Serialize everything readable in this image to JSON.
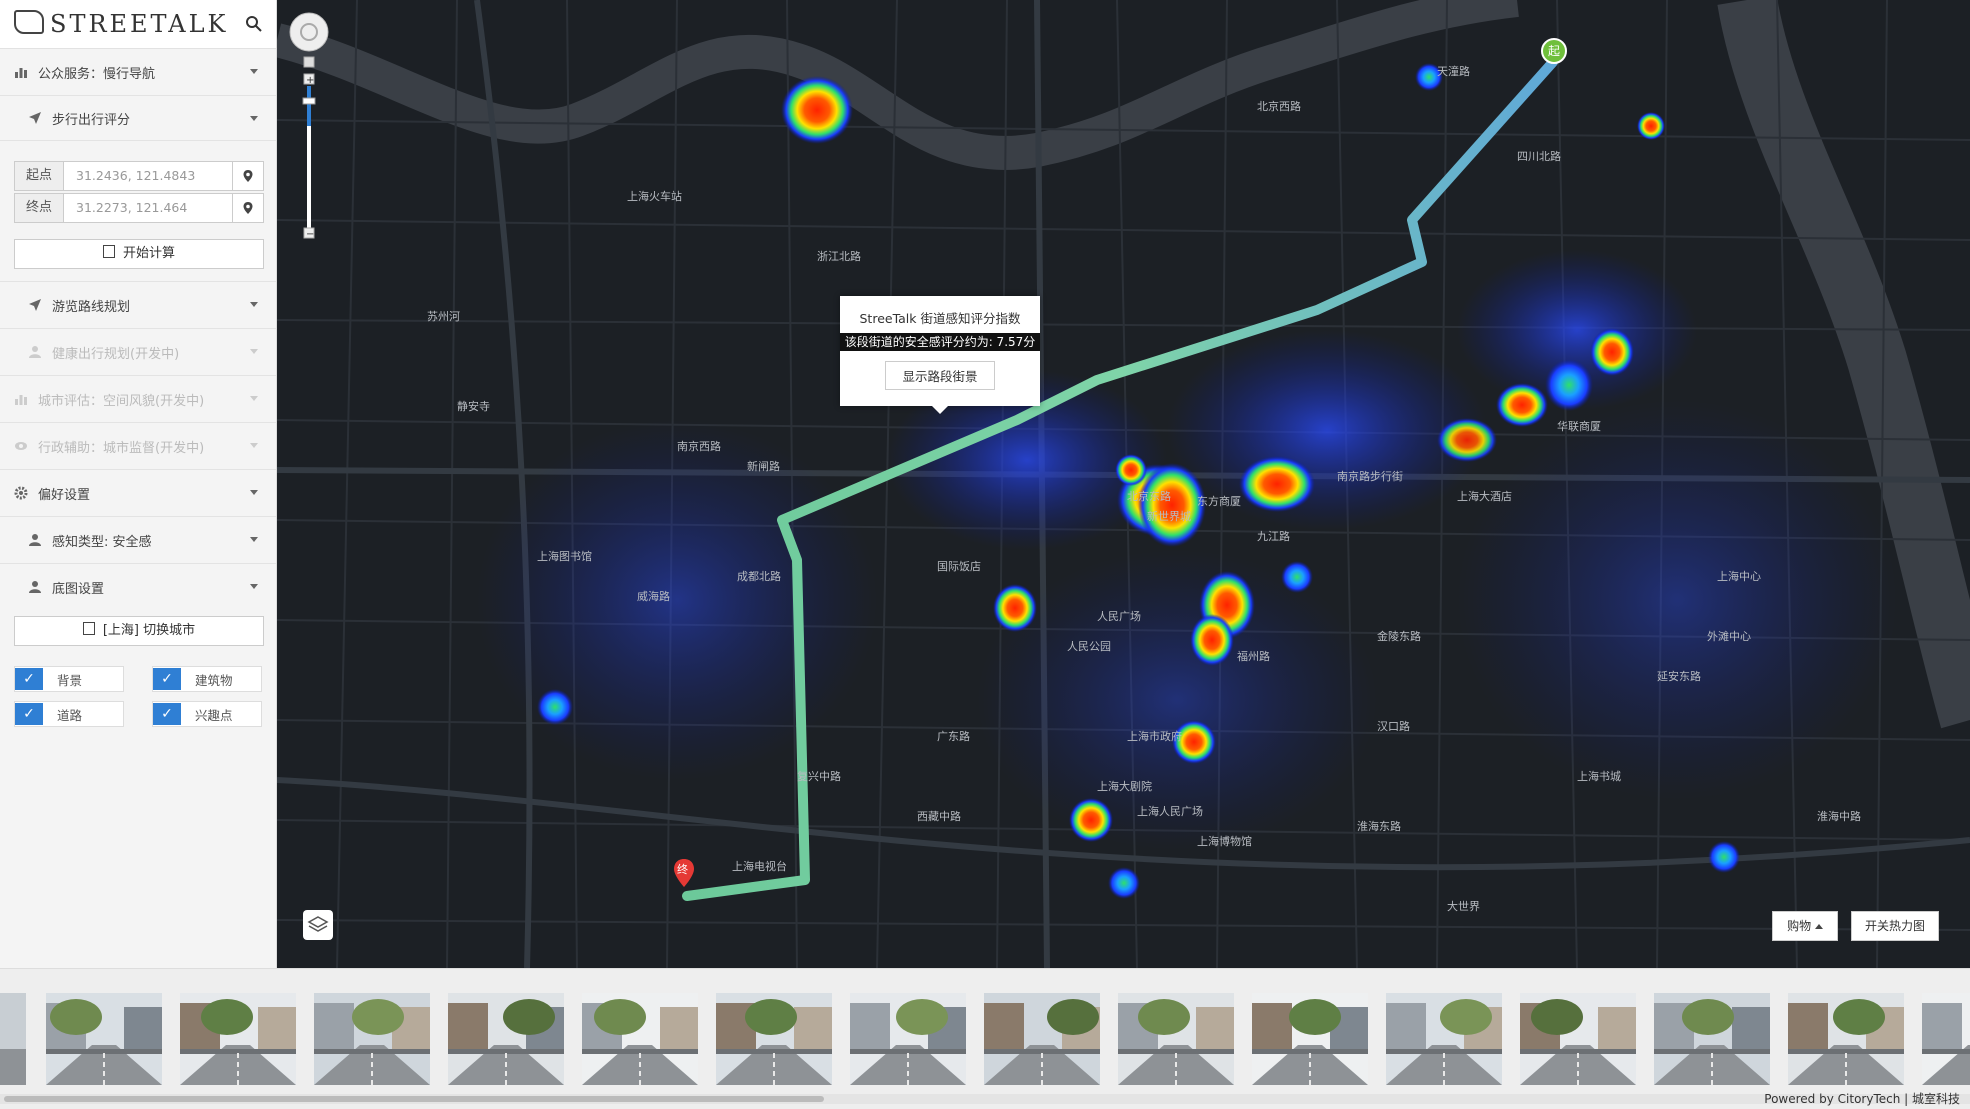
{
  "app": {
    "logo_text": "STREETALK"
  },
  "sidebar": {
    "menu": [
      {
        "label": "公众服务：慢行导航",
        "icon": "bar-chart-icon"
      },
      {
        "label": "步行出行评分",
        "icon": "navigation-arrow-icon"
      },
      {
        "label": "游览路线规划",
        "icon": "navigation-arrow-icon"
      },
      {
        "label": "健康出行规划(开发中)",
        "icon": "user-icon"
      },
      {
        "label": "城市评估：空间风貌(开发中)",
        "icon": "bar-chart-icon"
      },
      {
        "label": "行政辅助：城市监督(开发中)",
        "icon": "eye-icon"
      },
      {
        "label": "偏好设置",
        "icon": "gear-icon"
      },
      {
        "label": "感知类型: 安全感",
        "icon": "user-icon"
      },
      {
        "label": "底图设置",
        "icon": "user-icon"
      }
    ],
    "start_label": "起点",
    "start_value": "31.2436, 121.4843",
    "end_label": "终点",
    "end_value": "31.2273, 121.464",
    "calc_button": "开始计算",
    "switch_city_button": "[上海] 切换城市",
    "layers": [
      {
        "label": "背景",
        "checked": true
      },
      {
        "label": "建筑物",
        "checked": true
      },
      {
        "label": "道路",
        "checked": true
      },
      {
        "label": "兴趣点",
        "checked": true
      }
    ]
  },
  "map": {
    "popup": {
      "title": "StreeTalk 街道感知评分指数",
      "score_text": "该段街道的安全感评分约为: 7.57分",
      "button": "显示路段街景"
    },
    "start_marker": "起",
    "end_marker": "终",
    "category_select": "购物",
    "heatmap_button": "开关热力图",
    "labels": [
      {
        "t": "北京东路"
      },
      {
        "t": "南京路步行街"
      },
      {
        "t": "人民广场"
      },
      {
        "t": "人民公园"
      },
      {
        "t": "上海大剧院"
      },
      {
        "t": "上海市政府"
      },
      {
        "t": "新世界城"
      },
      {
        "t": "东方商厦"
      },
      {
        "t": "九江路"
      },
      {
        "t": "福州路"
      },
      {
        "t": "延安东路"
      },
      {
        "t": "外滩中心"
      },
      {
        "t": "上海大酒店"
      },
      {
        "t": "上海人民广场"
      },
      {
        "t": "淮海东路"
      },
      {
        "t": "上海博物馆"
      },
      {
        "t": "西藏中路"
      },
      {
        "t": "新闸路"
      },
      {
        "t": "北京西路"
      },
      {
        "t": "威海路"
      },
      {
        "t": "上海电视台"
      },
      {
        "t": "南京西路"
      },
      {
        "t": "静安寺"
      },
      {
        "t": "苏州河"
      },
      {
        "t": "上海火车站"
      },
      {
        "t": "天潼路"
      },
      {
        "t": "四川北路"
      },
      {
        "t": "上海中心"
      },
      {
        "t": "汉口路"
      },
      {
        "t": "上海图书馆"
      },
      {
        "t": "浙江北路"
      },
      {
        "t": "华联商厦"
      },
      {
        "t": "上海书城"
      },
      {
        "t": "国际饭店"
      },
      {
        "t": "金陵东路"
      },
      {
        "t": "广东路"
      },
      {
        "t": "淮海中路"
      },
      {
        "t": "复兴中路"
      },
      {
        "t": "成都北路"
      },
      {
        "t": "大世界"
      }
    ]
  },
  "strip": {
    "thumb_count": 15
  },
  "footer": {
    "credit": "Powered by CitoryTech | 城室科技"
  },
  "colors": {
    "route_blue": "#5fa8d8",
    "route_green": "#6cc99a",
    "accent": "#2f7fd4",
    "map_bg": "#1c2025"
  }
}
